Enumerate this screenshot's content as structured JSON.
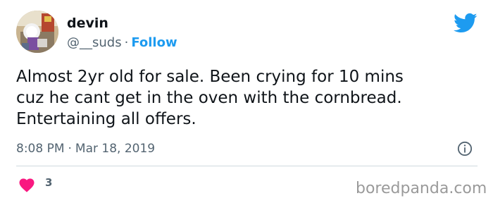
{
  "author": {
    "display_name": "devin",
    "handle": "@__suds",
    "separator": "·",
    "follow_label": "Follow"
  },
  "tweet": {
    "text": "Almost 2yr old for sale.  Been crying for 10 mins\ncuz he cant get in the oven with the cornbread.\nEntertaining all offers.",
    "time": "8:08 PM",
    "separator": "·",
    "date": "Mar 18, 2019",
    "like_count": "3"
  },
  "icons": {
    "brand": "twitter-bird-icon",
    "info": "info-icon",
    "like": "heart-icon"
  },
  "colors": {
    "accent": "#1d9bf0",
    "like": "#f91880",
    "text": "#0f1419",
    "secondary": "#536471",
    "divider": "#cfd9de"
  },
  "watermark": "boredpanda.com"
}
